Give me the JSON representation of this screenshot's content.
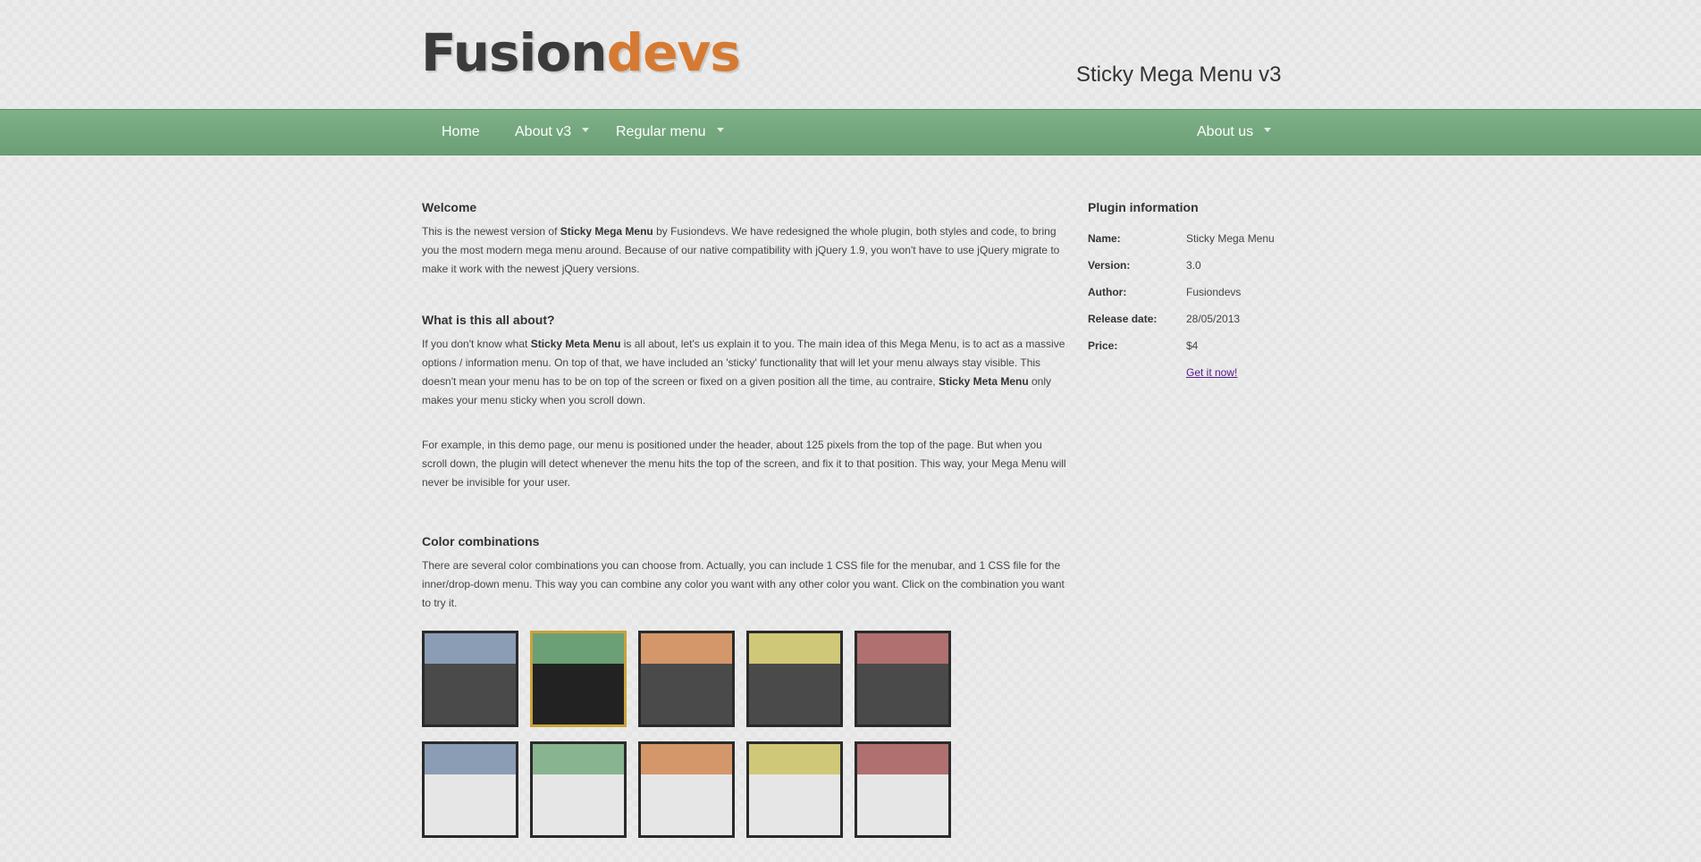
{
  "header": {
    "logo_part1": "Fusion",
    "logo_part2": "devs",
    "site_title": "Sticky Mega Menu v3"
  },
  "menu": {
    "items": [
      {
        "label": "Home",
        "has_dropdown": false
      },
      {
        "label": "About v3",
        "has_dropdown": true
      },
      {
        "label": "Regular menu",
        "has_dropdown": true
      },
      {
        "label": "About us",
        "has_dropdown": true
      }
    ]
  },
  "welcome": {
    "heading": "Welcome",
    "t1": "This is the newest version of ",
    "b1": "Sticky Mega Menu",
    "t2": " by Fusiondevs. We have redesigned the whole plugin, both styles and code, to bring you the most modern mega menu around. Because of our native compatibility with jQuery 1.9, you won't have to use jQuery migrate to make it work with the newest jQuery versions."
  },
  "about": {
    "heading": "What is this all about?",
    "t1": "If you don't know what ",
    "b1": "Sticky Meta Menu",
    "t2": " is all about, let's us explain it to you. The main idea of this Mega Menu, is to act as a massive options / information menu. On top of that, we have included an 'sticky' functionality that will let your menu always stay visible. This doesn't mean your menu has to be on top of the screen or fixed on a given position all the time, au contraire, ",
    "b2": "Sticky Meta Menu",
    "t3": " only makes your menu sticky when you scroll down."
  },
  "example": {
    "text": "For example, in this demo page, our menu is positioned under the header, about 125 pixels from the top of the page. But when you scroll down, the plugin will detect whenever the menu hits the top of the screen, and fix it to that position. This way, your Mega Menu will never be invisible for your user."
  },
  "colors": {
    "heading": "Color combinations",
    "text": "There are several color combinations you can choose from. Actually, you can include 1 CSS file for the menubar, and 1 CSS file for the inner/drop-down menu. This way you can combine any color you want with any other color you want. Click on the combination you want to try it.",
    "swatches_dark": [
      {
        "top": "#8a9db5",
        "bottom": "#4a4a4a",
        "active": false
      },
      {
        "top": "#6b9f76",
        "bottom": "#222222",
        "active": true
      },
      {
        "top": "#d4976a",
        "bottom": "#4a4a4a",
        "active": false
      },
      {
        "top": "#cfc878",
        "bottom": "#4a4a4a",
        "active": false
      },
      {
        "top": "#b07070",
        "bottom": "#4a4a4a",
        "active": false
      }
    ],
    "swatches_light": [
      {
        "top": "#8a9db5",
        "bottom": "#e6e6e6",
        "active": false
      },
      {
        "top": "#88b490",
        "bottom": "#e6e6e6",
        "active": false
      },
      {
        "top": "#d4976a",
        "bottom": "#e6e6e6",
        "active": false
      },
      {
        "top": "#cfc878",
        "bottom": "#e6e6e6",
        "active": false
      },
      {
        "top": "#b07070",
        "bottom": "#e6e6e6",
        "active": false
      }
    ],
    "active_border": "#c8a23a"
  },
  "plugin_info": {
    "heading": "Plugin information",
    "rows": [
      {
        "key": "Name:",
        "value": "Sticky Mega Menu"
      },
      {
        "key": "Version:",
        "value": "3.0"
      },
      {
        "key": "Author:",
        "value": "Fusiondevs"
      },
      {
        "key": "Release date:",
        "value": "28/05/2013"
      },
      {
        "key": "Price:",
        "value": "$4"
      }
    ],
    "link_label": "Get it now!"
  },
  "theme": {
    "menubar_color": "#6b9f76",
    "logo_accent": "#d67a33"
  }
}
